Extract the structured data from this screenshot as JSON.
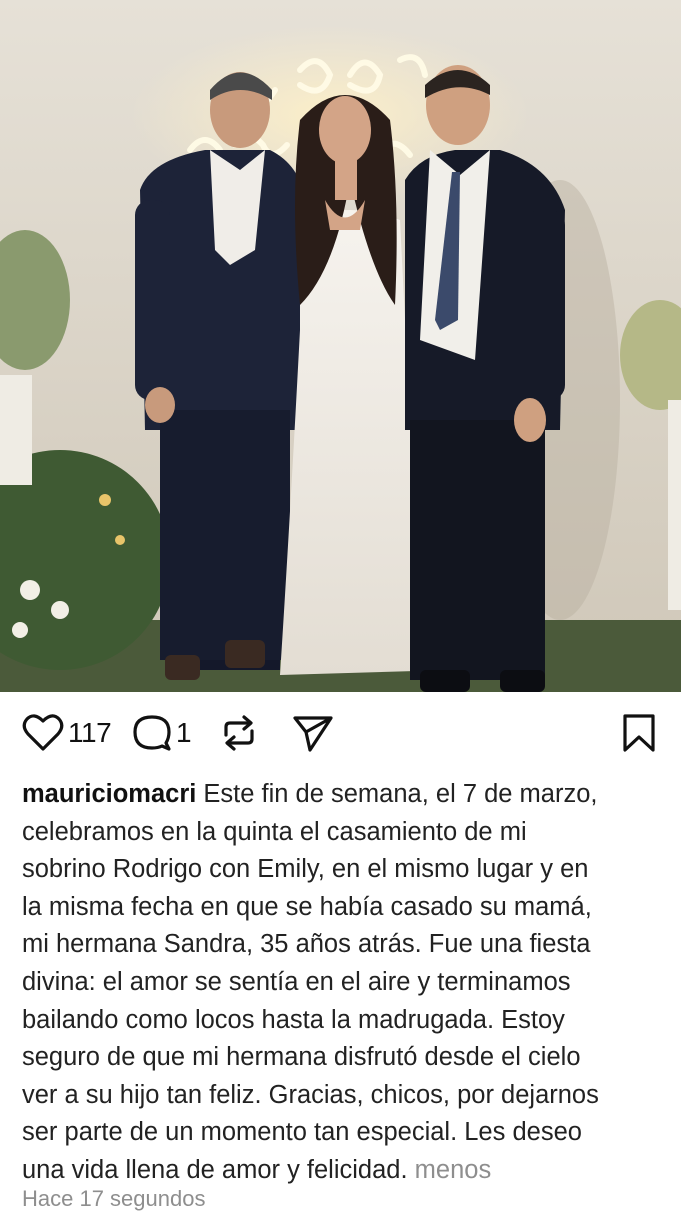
{
  "post": {
    "image_alt": "Foto de casamiento",
    "actions": {
      "like_count": "117",
      "comment_count": "1"
    },
    "caption": {
      "username": "mauriciomacri",
      "lines": [
        " Este fin de semana, el 7 de marzo,",
        "celebramos en la quinta el casamiento de mi",
        "sobrino Rodrigo con Emily, en el mismo lugar y en",
        "la misma fecha en que se había casado su mamá,",
        "mi hermana Sandra, 35 años atrás. Fue una fiesta",
        "divina: el amor se sentía en el aire y terminamos",
        "bailando como locos hasta la madrugada. Estoy",
        "seguro de que mi hermana disfrutó desde el cielo",
        "ver a su hijo tan feliz. Gracias, chicos, por dejarnos",
        "ser parte de un momento tan especial. Les deseo",
        "una vida llena de amor y felicidad. "
      ],
      "more_label": "menos"
    },
    "timestamp": "Hace 17 segundos"
  },
  "icons": {
    "like": "heart-icon",
    "comment": "comment-bubble-icon",
    "repost": "repost-icon",
    "share": "send-icon",
    "save": "bookmark-icon"
  },
  "colors": {
    "text": "#111111",
    "muted": "#8e8e8e",
    "background": "#ffffff"
  }
}
